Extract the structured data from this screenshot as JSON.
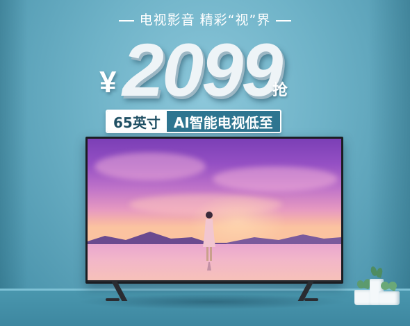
{
  "headline": {
    "text": "电视影音 精彩“视”界"
  },
  "price": {
    "currency": "¥",
    "amount": "2099",
    "suffix": "抢"
  },
  "badges": {
    "size": "65英寸",
    "feature": "AI智能电视低至"
  },
  "colors": {
    "background": "#6fb3c8",
    "accent_dark": "#2e7590",
    "price_text": "#eef4f7",
    "tv_frame": "#1b1d22"
  },
  "icons": {
    "tv": "television-icon",
    "plant": "succulent-plant-icon"
  }
}
